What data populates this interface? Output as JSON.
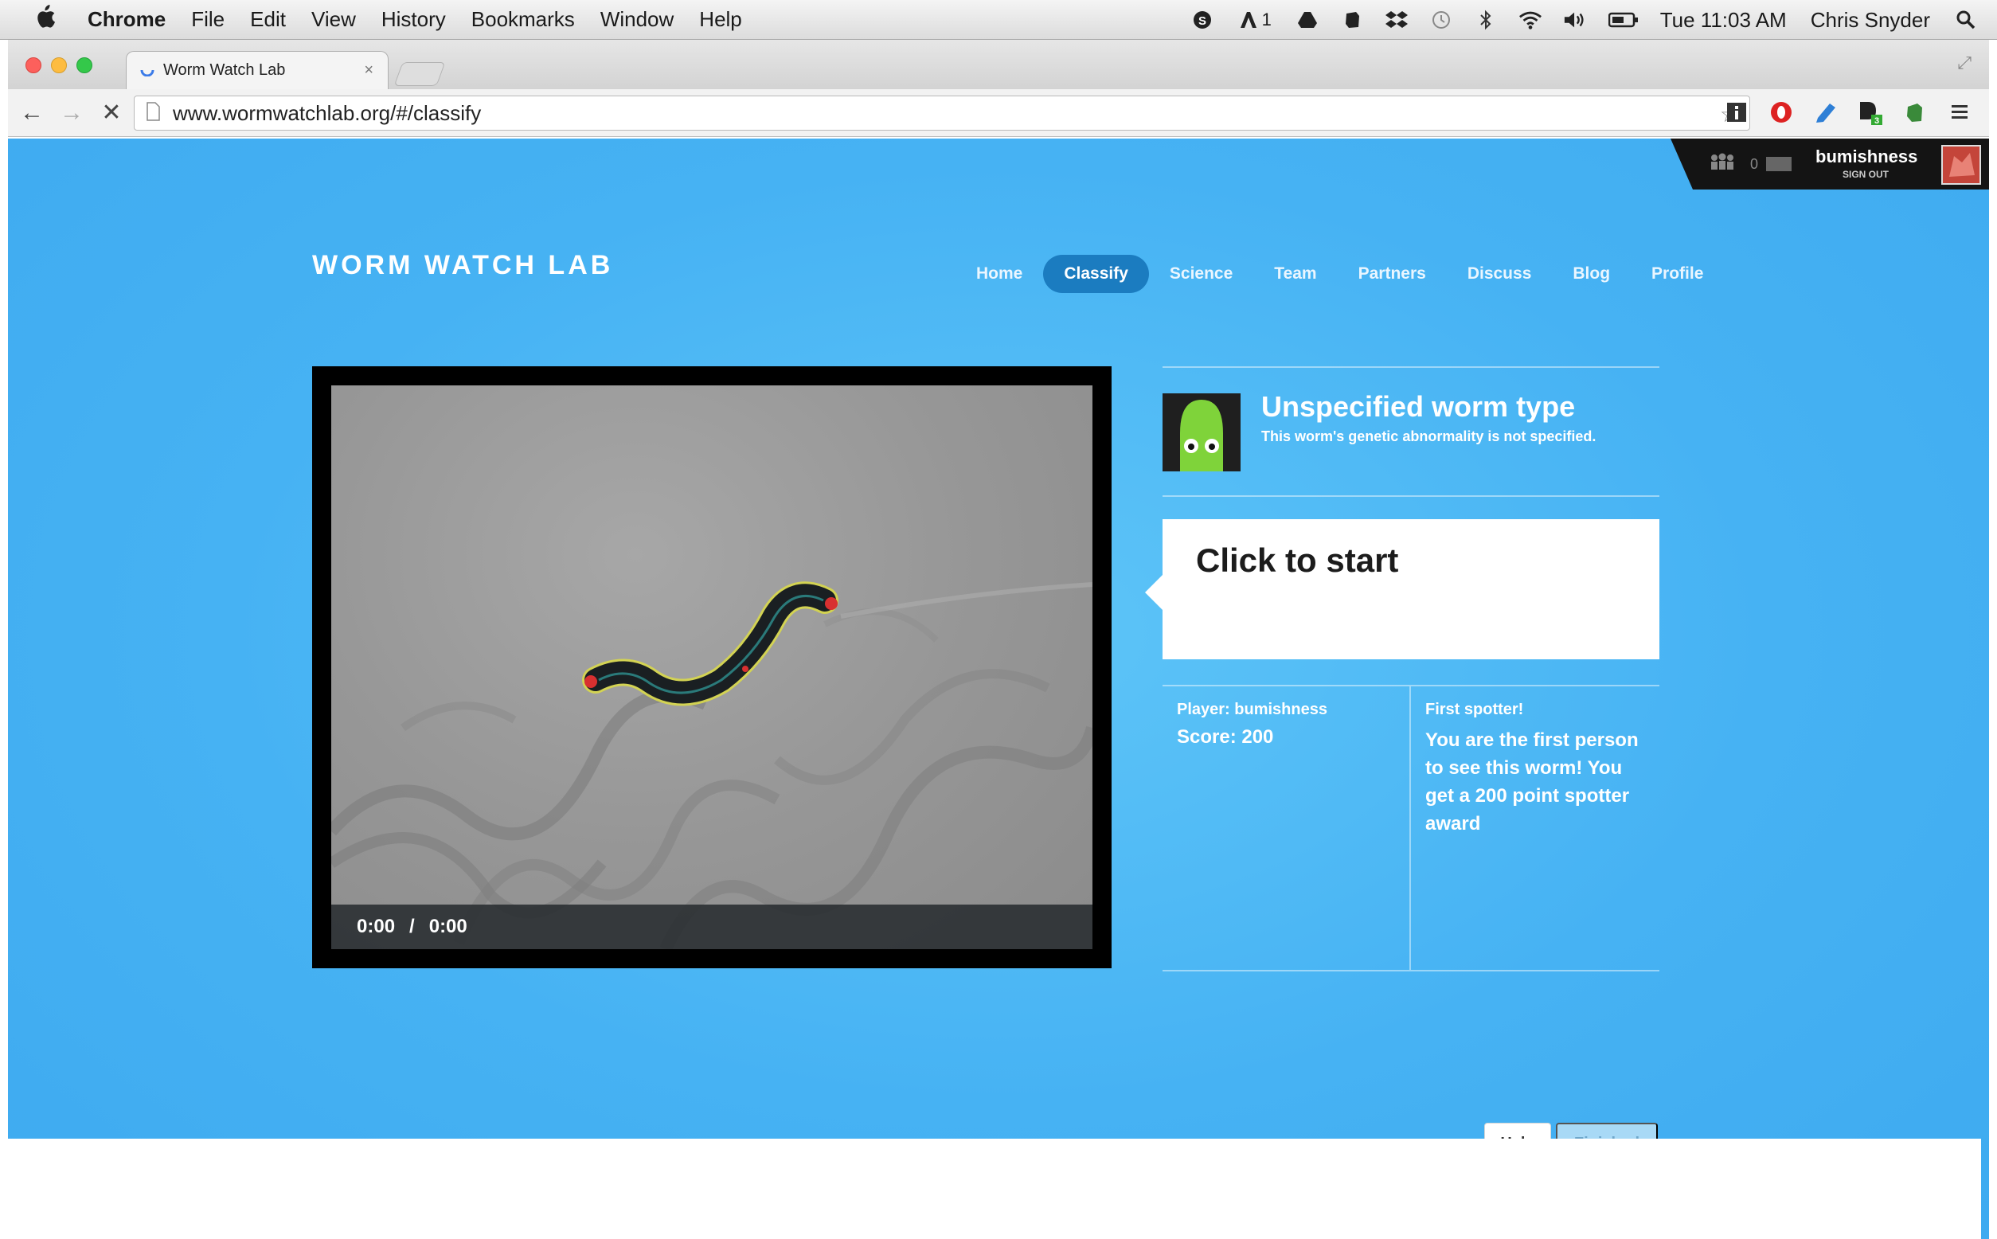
{
  "menubar": {
    "app_name": "Chrome",
    "items": [
      "File",
      "Edit",
      "View",
      "History",
      "Bookmarks",
      "Window",
      "Help"
    ],
    "status_badge": "1",
    "clock": "Tue 11:03 AM",
    "user": "Chris Snyder",
    "status_icons": [
      "skype-icon",
      "adobe-icon",
      "google-drive-icon",
      "evernote-icon",
      "dropbox-icon",
      "time-machine-icon",
      "bluetooth-icon",
      "wifi-icon",
      "volume-icon",
      "battery-icon",
      "spotlight-icon"
    ]
  },
  "browser": {
    "tab_title": "Worm Watch Lab",
    "url": "www.wormwatchlab.org/#/classify",
    "extensions": [
      "info-icon",
      "opera-icon",
      "pencil-icon",
      "dashlane-icon",
      "evernote-icon",
      "menu-icon"
    ],
    "extension_badge": "3"
  },
  "site": {
    "logo": "WORM WATCH LAB",
    "nav": [
      "Home",
      "Classify",
      "Science",
      "Team",
      "Partners",
      "Discuss",
      "Blog",
      "Profile"
    ],
    "active_nav": "Classify",
    "user_bar": {
      "count": "0",
      "username": "bumishness",
      "signout": "SIGN OUT"
    }
  },
  "video": {
    "current_time": "0:00",
    "separator": "/",
    "duration": "0:00"
  },
  "classify": {
    "worm_type": "Unspecified worm type",
    "worm_desc": "This worm's genetic abnormality is not specified.",
    "prompt": "Click to start",
    "player_label": "Player: bumishness",
    "score_label": "Score: 200",
    "spotter_title": "First spotter!",
    "spotter_text": "You are the first person to see this worm! You get a 200 point spotter award",
    "help_button": "Help",
    "finished_button": "Finished"
  },
  "colors": {
    "page_bg": "#46b2f3",
    "active_nav": "#1b7cc0",
    "worm_avatar": "#7fd33a"
  }
}
